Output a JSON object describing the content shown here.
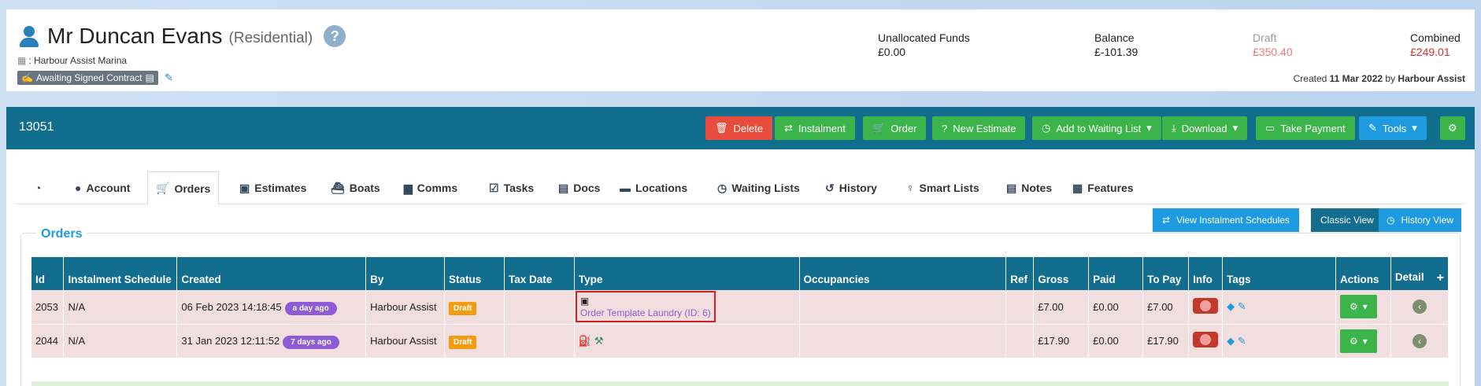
{
  "customer": {
    "name": "Mr Duncan Evans",
    "type": "(Residential)",
    "help": "?",
    "marina": ": Harbour Assist Marina",
    "contract_status": "Awaiting Signed Contract"
  },
  "finance": {
    "unallocated_label": "Unallocated Funds",
    "unallocated_value": "£0.00",
    "balance_label": "Balance",
    "balance_value": "£-101.39",
    "draft_label": "Draft",
    "draft_value": "£350.40",
    "combined_label": "Combined",
    "combined_value": "£249.01"
  },
  "created": {
    "prefix": "Created",
    "date": "11 Mar 2022",
    "by_word": "by",
    "by": "Harbour Assist"
  },
  "record_id": "13051",
  "toolbar": {
    "delete": "Delete",
    "instalment": "Instalment",
    "order": "Order",
    "new_estimate": "New Estimate",
    "waiting_list": "Add to Waiting List",
    "download": "Download",
    "take_payment": "Take Payment",
    "tools": "Tools"
  },
  "tabs": [
    {
      "label": "Account"
    },
    {
      "label": "Orders"
    },
    {
      "label": "Estimates"
    },
    {
      "label": "Boats"
    },
    {
      "label": "Comms"
    },
    {
      "label": "Tasks"
    },
    {
      "label": "Docs"
    },
    {
      "label": "Locations"
    },
    {
      "label": "Waiting Lists"
    },
    {
      "label": "History"
    },
    {
      "label": "Smart Lists"
    },
    {
      "label": "Notes"
    },
    {
      "label": "Features"
    }
  ],
  "orders": {
    "legend": "Orders",
    "view_schedules": "View Instalment Schedules",
    "classic_view": "Classic View",
    "history_view": "History View",
    "columns": [
      "Id",
      "Instalment Schedule",
      "Created",
      "By",
      "Status",
      "Tax Date",
      "Type",
      "Occupancies",
      "Ref",
      "Gross",
      "Paid",
      "To Pay",
      "Info",
      "Tags",
      "Actions",
      "Detail"
    ],
    "rows": [
      {
        "id": "2053",
        "schedule": "N/A",
        "created": "06 Feb 2023 14:18:45",
        "ago": "a day ago",
        "by": "Harbour Assist",
        "status": "Draft",
        "tax_date": "",
        "type": "Order Template Laundry (ID: 6)",
        "occupancies": "",
        "ref": "",
        "gross": "£7.00",
        "paid": "£0.00",
        "to_pay": "£7.00"
      },
      {
        "id": "2044",
        "schedule": "N/A",
        "created": "31 Jan 2023 12:11:52",
        "ago": "7 days ago",
        "by": "Harbour Assist",
        "status": "Draft",
        "tax_date": "",
        "type": "",
        "occupancies": "",
        "ref": "",
        "gross": "£17.90",
        "paid": "£0.00",
        "to_pay": "£17.90"
      }
    ]
  }
}
